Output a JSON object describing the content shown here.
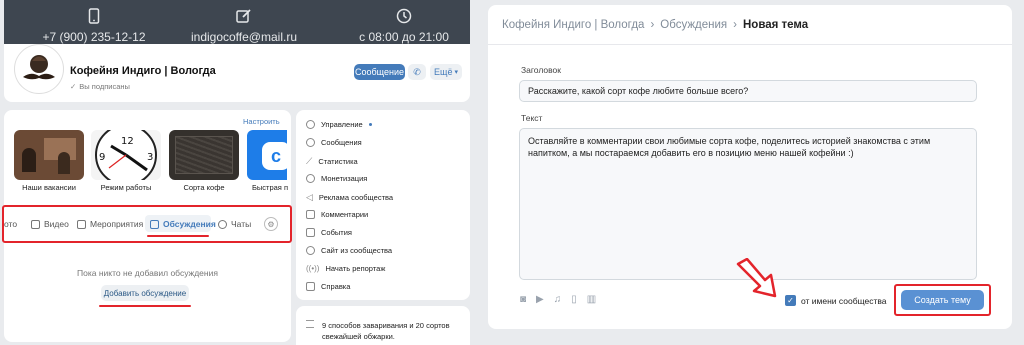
{
  "contacts": {
    "phone": "+7 (900) 235-12-12",
    "email": "indigocoffe@mail.ru",
    "hours": "с 08:00 до 21:00"
  },
  "community": {
    "name": "Кофейня Индиго | Вологда",
    "subscribed": "Вы подписаны",
    "message_btn": "Сообщение",
    "more_btn": "Ещё"
  },
  "albums": {
    "configure": "Настроить",
    "items": [
      {
        "label": "Наши вакансии"
      },
      {
        "label": "Режим работы"
      },
      {
        "label": "Сорта кофе"
      },
      {
        "label": "Быстрая п"
      }
    ]
  },
  "tabs": [
    {
      "label": "ото"
    },
    {
      "label": "Видео"
    },
    {
      "label": "Мероприятия"
    },
    {
      "label": "Обсуждения"
    },
    {
      "label": "Чаты"
    }
  ],
  "discussions": {
    "empty_text": "Пока никто не добавил обсуждения",
    "add_btn": "Добавить обсуждение"
  },
  "menu": [
    {
      "label": "Управление"
    },
    {
      "label": "Сообщения"
    },
    {
      "label": "Статистика"
    },
    {
      "label": "Монетизация"
    },
    {
      "label": "Реклама сообщества"
    },
    {
      "label": "Комментарии"
    },
    {
      "label": "События"
    },
    {
      "label": "Сайт из сообщества"
    },
    {
      "label": "Начать репортаж"
    },
    {
      "label": "Справка"
    }
  ],
  "post_snippet": {
    "line1": "9 способов заваривания и 20 сортов",
    "line2": "свежайшей обжарки."
  },
  "new_topic": {
    "breadcrumb": [
      "Кофейня Индиго | Вологда",
      "Обсуждения",
      "Новая тема"
    ],
    "title_label": "Заголовок",
    "title_value": "Расскажите, какой сорт кофе любите больше всего?",
    "text_label": "Текст",
    "text_value": "Оставляйте в комментарии свои любимые сорта кофе, поделитесь историей знакомства с этим напитком, а мы постараемся добавить его в позицию меню нашей кофейни :)",
    "as_community": "от имени сообщества",
    "create_btn": "Создать тему"
  },
  "colors": {
    "accent": "#447bba",
    "annotation_red": "#e3242b",
    "cover": "#3e4650"
  }
}
